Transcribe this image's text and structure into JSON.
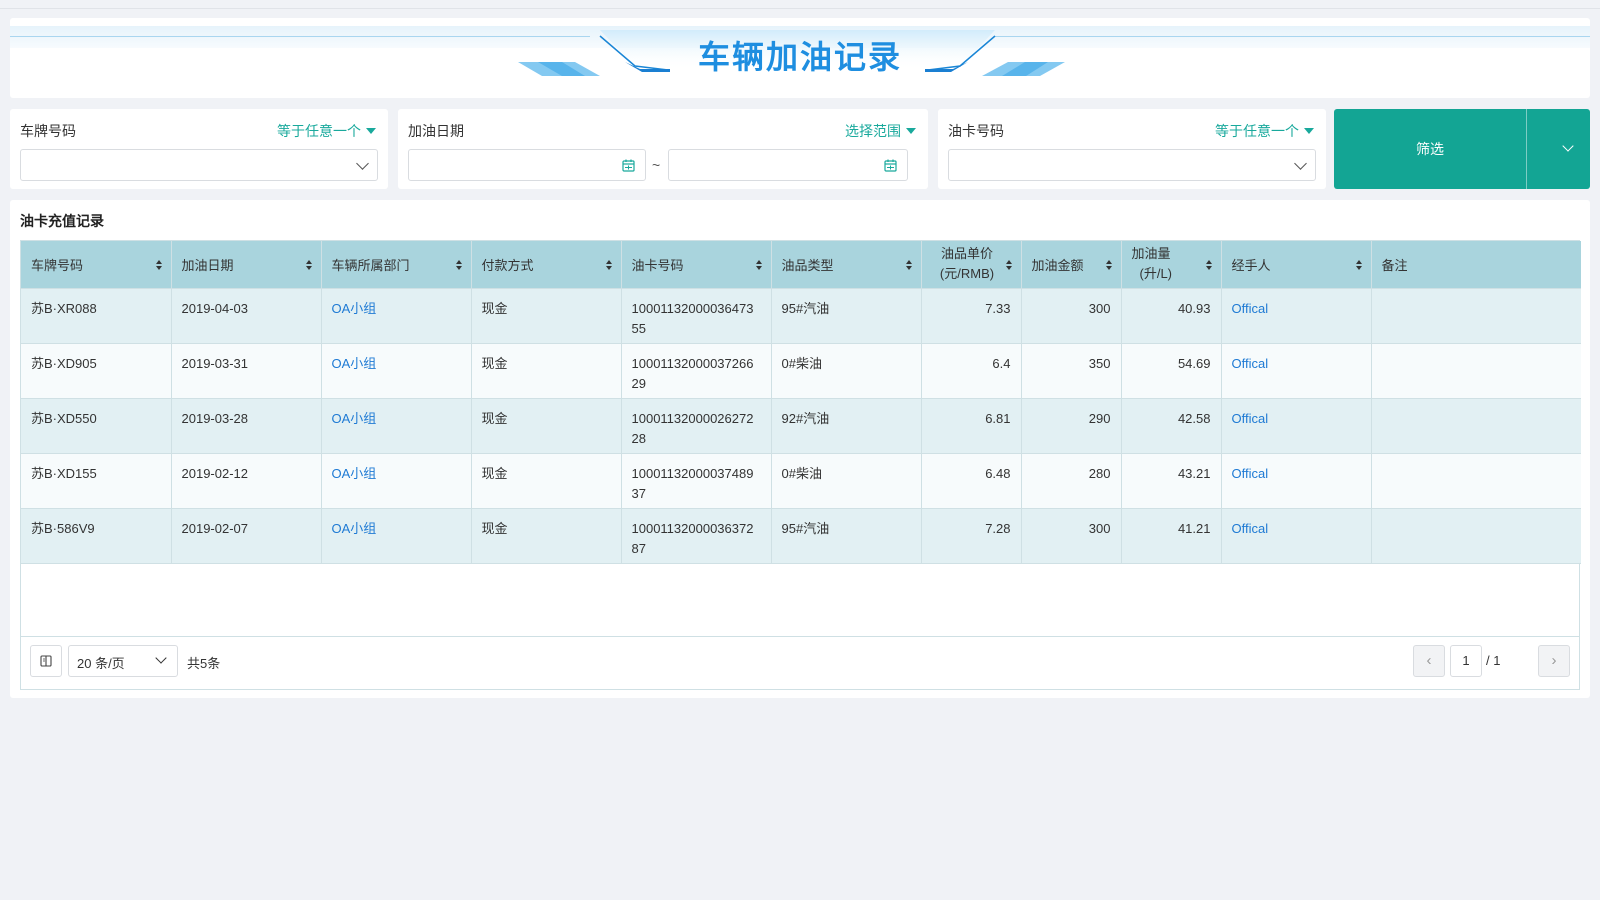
{
  "header": {
    "title": "车辆加油记录"
  },
  "filters": {
    "plate": {
      "label": "车牌号码",
      "operator": "等于任意一个",
      "value": ""
    },
    "date": {
      "label": "加油日期",
      "operator": "选择范围",
      "start": "",
      "end": "",
      "separator": "~"
    },
    "card": {
      "label": "油卡号码",
      "operator": "等于任意一个",
      "value": ""
    },
    "submit_label": "筛选"
  },
  "table": {
    "title": "油卡充值记录",
    "columns": {
      "plate": "车牌号码",
      "date": "加油日期",
      "dept": "车辆所属部门",
      "pay": "付款方式",
      "card": "油卡号码",
      "fuel": "油品类型",
      "price_l1": "油品单价",
      "price_l2": "(元/RMB)",
      "amount": "加油金额",
      "qty_l1": "加油量",
      "qty_l2": "(升/L)",
      "handler": "经手人",
      "remark": "备注"
    },
    "rows": [
      {
        "plate": "苏B·XR088",
        "date": "2019-04-03",
        "dept": "OA小组",
        "pay": "现金",
        "card": "1000113200003647355",
        "fuel": "95#汽油",
        "price": "7.33",
        "amount": "300",
        "qty": "40.93",
        "handler": "Offical",
        "remark": ""
      },
      {
        "plate": "苏B·XD905",
        "date": "2019-03-31",
        "dept": "OA小组",
        "pay": "现金",
        "card": "1000113200003726629",
        "fuel": "0#柴油",
        "price": "6.4",
        "amount": "350",
        "qty": "54.69",
        "handler": "Offical",
        "remark": ""
      },
      {
        "plate": "苏B·XD550",
        "date": "2019-03-28",
        "dept": "OA小组",
        "pay": "现金",
        "card": "1000113200002627228",
        "fuel": "92#汽油",
        "price": "6.81",
        "amount": "290",
        "qty": "42.58",
        "handler": "Offical",
        "remark": ""
      },
      {
        "plate": "苏B·XD155",
        "date": "2019-02-12",
        "dept": "OA小组",
        "pay": "现金",
        "card": "1000113200003748937",
        "fuel": "0#柴油",
        "price": "6.48",
        "amount": "280",
        "qty": "43.21",
        "handler": "Offical",
        "remark": ""
      },
      {
        "plate": "苏B·586V9",
        "date": "2019-02-07",
        "dept": "OA小组",
        "pay": "现金",
        "card": "1000113200003637287",
        "fuel": "95#汽油",
        "price": "7.28",
        "amount": "300",
        "qty": "41.21",
        "handler": "Offical",
        "remark": ""
      }
    ]
  },
  "pagination": {
    "page_size": "20 条/页",
    "total": "共5条",
    "current": "1",
    "of_total": "/ 1",
    "prev_icon": "‹",
    "next_icon": "›"
  },
  "colors": {
    "accent": "#13a594",
    "header_bg": "#a9d4dd",
    "link": "#1e7ad4",
    "title": "#1e8ee0"
  }
}
